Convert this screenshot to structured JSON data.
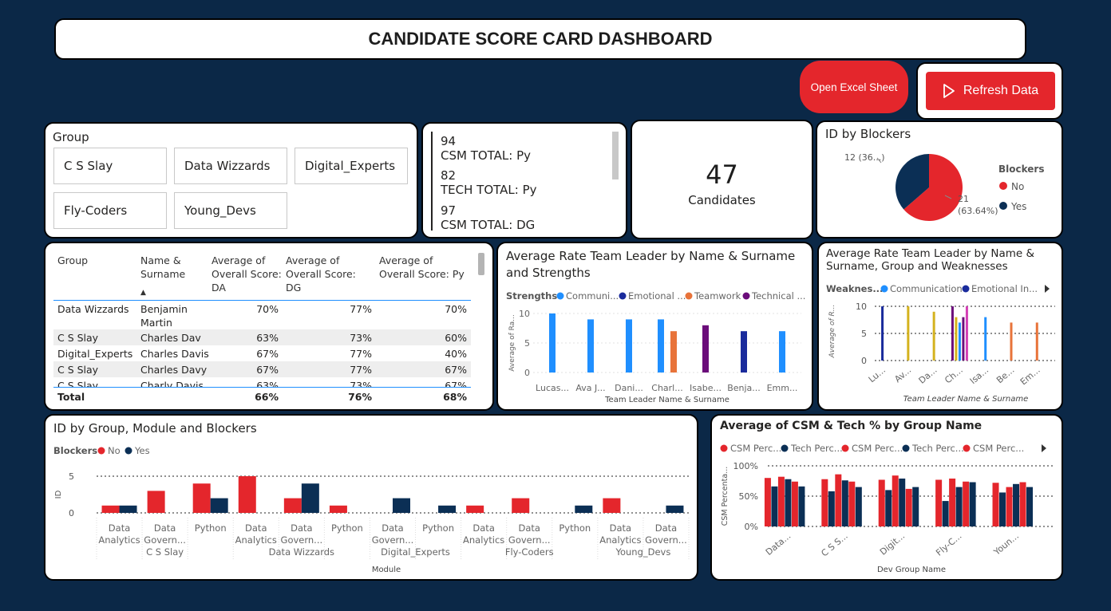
{
  "header": {
    "title": "CANDIDATE SCORE CARD DASHBOARD"
  },
  "buttons": {
    "open_excel": "Open Excel Sheet",
    "refresh": "Refresh Data"
  },
  "colors": {
    "background": "#0b2847",
    "red": "#e4262c",
    "navy": "#0b2f55",
    "blue": "#1f8fff",
    "darkblue": "#1a2b9c",
    "orange": "#e8733a",
    "purple": "#6b0c7a",
    "gold": "#d4b21e",
    "magenta": "#d43fb5",
    "skyblue": "#1f8fff"
  },
  "group_slicer": {
    "title": "Group",
    "items": [
      "C S Slay",
      "Data Wizzards",
      "Digital_Experts",
      "Fly-Coders",
      "Young_Devs"
    ]
  },
  "multi_card": {
    "items": [
      {
        "value": "94",
        "label": "CSM TOTAL: Py"
      },
      {
        "value": "82",
        "label": "TECH TOTAL: Py"
      },
      {
        "value": "97",
        "label": "CSM TOTAL: DG"
      }
    ]
  },
  "candidates_card": {
    "value": "47",
    "label": "Candidates"
  },
  "pie_blockers": {
    "title": "ID by Blockers",
    "legend_title": "Blockers",
    "slices": [
      {
        "name": "No",
        "value": 21,
        "label": "21",
        "pct_label": "(63.64%)",
        "color": "#e4262c"
      },
      {
        "name": "Yes",
        "value": 12,
        "label": "12 (36...)",
        "color": "#0b2f55"
      }
    ]
  },
  "score_table": {
    "headers": [
      "Group",
      "Name & Surname",
      "Average of Overall Score: DA",
      "Average of Overall Score: DG",
      "Average of Overall Score: Py"
    ],
    "rows": [
      [
        "Data Wizzards",
        "Benjamin Martin",
        "70%",
        "77%",
        "70%"
      ],
      [
        "C S Slay",
        "Charles Dav",
        "63%",
        "73%",
        "60%"
      ],
      [
        "Digital_Experts",
        "Charles Davis",
        "67%",
        "77%",
        "40%"
      ],
      [
        "C S Slay",
        "Charles Davy",
        "67%",
        "77%",
        "67%"
      ],
      [
        "C S Slay",
        "Charly Davis",
        "63%",
        "73%",
        "67%"
      ]
    ],
    "total": [
      "Total",
      "",
      "66%",
      "76%",
      "68%"
    ]
  },
  "chart_data": [
    {
      "id": "strengths",
      "type": "bar",
      "title": "Average Rate Team Leader by Name & Surname and Strengths",
      "legend_title": "Strengths",
      "xlabel": "Team Leader Name & Surname",
      "ylabel": "Average of Ra...",
      "ylim": [
        0,
        10
      ],
      "yticks": [
        0,
        5,
        10
      ],
      "categories": [
        "Lucas...",
        "Ava J...",
        "Dani...",
        "Charl...",
        "Isabe...",
        "Benja...",
        "Emm..."
      ],
      "series": [
        {
          "name": "Communi...",
          "color": "#1f8fff",
          "values": [
            10,
            9,
            9,
            9,
            null,
            null,
            7
          ]
        },
        {
          "name": "Emotional ...",
          "color": "#1a2b9c",
          "values": [
            null,
            null,
            null,
            null,
            null,
            7,
            null
          ]
        },
        {
          "name": "Teamwork",
          "color": "#e8733a",
          "values": [
            null,
            null,
            null,
            7,
            null,
            null,
            null
          ]
        },
        {
          "name": "Technical ...",
          "color": "#6b0c7a",
          "values": [
            null,
            null,
            null,
            null,
            8,
            null,
            null
          ]
        }
      ]
    },
    {
      "id": "weaknesses",
      "type": "bar",
      "title": "Average Rate Team Leader by Name & Surname, Group and Weaknesses",
      "legend_title": "Weaknes...",
      "xlabel": "Team Leader Name & Surname",
      "ylabel": "Average of R...",
      "ylim": [
        0,
        10
      ],
      "yticks": [
        0,
        5,
        10
      ],
      "categories": [
        "Lu...",
        "Av...",
        "Da...",
        "Ch...",
        "Isa...",
        "Be...",
        "Em..."
      ],
      "series": [
        {
          "name": "Communication",
          "color": "#1f8fff"
        },
        {
          "name": "Emotional In...",
          "color": "#1a2b9c"
        }
      ],
      "bars": [
        {
          "cat": 0,
          "value": 10,
          "color": "#1a2b9c"
        },
        {
          "cat": 1,
          "value": 10,
          "color": "#d4b21e"
        },
        {
          "cat": 2,
          "value": 9,
          "color": "#d4b21e"
        },
        {
          "cat": 3,
          "value": 10,
          "color": "#6b0c7a"
        },
        {
          "cat": 3,
          "value": 8,
          "color": "#d4b21e"
        },
        {
          "cat": 3,
          "value": 7,
          "color": "#1f8fff"
        },
        {
          "cat": 3,
          "value": 8,
          "color": "#6b0c7a"
        },
        {
          "cat": 3,
          "value": 10,
          "color": "#d43fb5"
        },
        {
          "cat": 4,
          "value": 8,
          "color": "#1f8fff"
        },
        {
          "cat": 5,
          "value": 7,
          "color": "#e8733a"
        },
        {
          "cat": 6,
          "value": 7,
          "color": "#e8733a"
        }
      ]
    },
    {
      "id": "group_module",
      "type": "bar",
      "title": "ID by Group, Module and Blockers",
      "legend_title": "Blockers",
      "xlabel": "Module",
      "ylabel": "ID",
      "ylim": [
        0,
        5
      ],
      "yticks": [
        0,
        5
      ],
      "series": [
        {
          "name": "No",
          "color": "#e4262c"
        },
        {
          "name": "Yes",
          "color": "#0b2f55"
        }
      ],
      "groups": [
        {
          "name": "C S Slay",
          "modules": [
            {
              "label": "Data Analytics",
              "no": 1,
              "yes": 1
            },
            {
              "label": "Data Govern...",
              "no": 3,
              "yes": null
            },
            {
              "label": "Python",
              "no": 4,
              "yes": 2
            }
          ]
        },
        {
          "name": "Data Wizzards",
          "modules": [
            {
              "label": "Data Analytics",
              "no": 5,
              "yes": null
            },
            {
              "label": "Data Govern...",
              "no": 2,
              "yes": 4
            },
            {
              "label": "Python",
              "no": 1,
              "yes": null
            }
          ]
        },
        {
          "name": "Digital_Experts",
          "modules": [
            {
              "label": "Data Govern...",
              "no": null,
              "yes": 2
            },
            {
              "label": "Python",
              "no": null,
              "yes": 1
            }
          ]
        },
        {
          "name": "Fly-Coders",
          "modules": [
            {
              "label": "Data Analytics",
              "no": 1,
              "yes": null
            },
            {
              "label": "Data Govern...",
              "no": 2,
              "yes": null
            },
            {
              "label": "Python",
              "no": null,
              "yes": 1
            }
          ]
        },
        {
          "name": "Young_Devs",
          "modules": [
            {
              "label": "Data Analytics",
              "no": 2,
              "yes": null
            },
            {
              "label": "Data Govern...",
              "no": null,
              "yes": 1
            }
          ]
        }
      ]
    },
    {
      "id": "csm_tech",
      "type": "bar",
      "title": "Average of CSM & Tech % by Group Name",
      "xlabel": "Dev Group Name",
      "ylabel": "CSM Percenta...",
      "ylim": [
        0,
        1
      ],
      "yticks": [
        0,
        0.5,
        1
      ],
      "ytick_labels": [
        "0%",
        "50%",
        "100%"
      ],
      "categories": [
        "Data...",
        "C S S...",
        "Digit...",
        "Fly-C...",
        "Youn..."
      ],
      "legend": [
        {
          "name": "CSM Perc...",
          "color": "#e4262c"
        },
        {
          "name": "Tech Perc...",
          "color": "#0b2f55"
        },
        {
          "name": "CSM Perc...",
          "color": "#e4262c"
        },
        {
          "name": "Tech Perc...",
          "color": "#0b2f55"
        },
        {
          "name": "CSM Perc...",
          "color": "#e4262c"
        }
      ],
      "series": [
        {
          "name": "CSM Perc...",
          "color": "#e4262c",
          "values": [
            0.8,
            0.78,
            0.77,
            0.77,
            0.72
          ]
        },
        {
          "name": "Tech Perc...",
          "color": "#0b2f55",
          "values": [
            0.66,
            0.58,
            0.6,
            0.42,
            0.56
          ]
        },
        {
          "name": "CSM Perc...",
          "color": "#e4262c",
          "values": [
            0.82,
            0.86,
            0.84,
            0.79,
            0.65
          ]
        },
        {
          "name": "Tech Perc...",
          "color": "#0b2f55",
          "values": [
            0.78,
            0.76,
            0.79,
            0.65,
            0.7
          ]
        },
        {
          "name": "CSM Perc...",
          "color": "#e4262c",
          "values": [
            0.74,
            0.74,
            0.62,
            0.74,
            0.73
          ]
        },
        {
          "name": "Tech Perc...",
          "color": "#0b2f55",
          "values": [
            0.66,
            0.65,
            0.65,
            0.73,
            0.65
          ]
        }
      ]
    }
  ]
}
